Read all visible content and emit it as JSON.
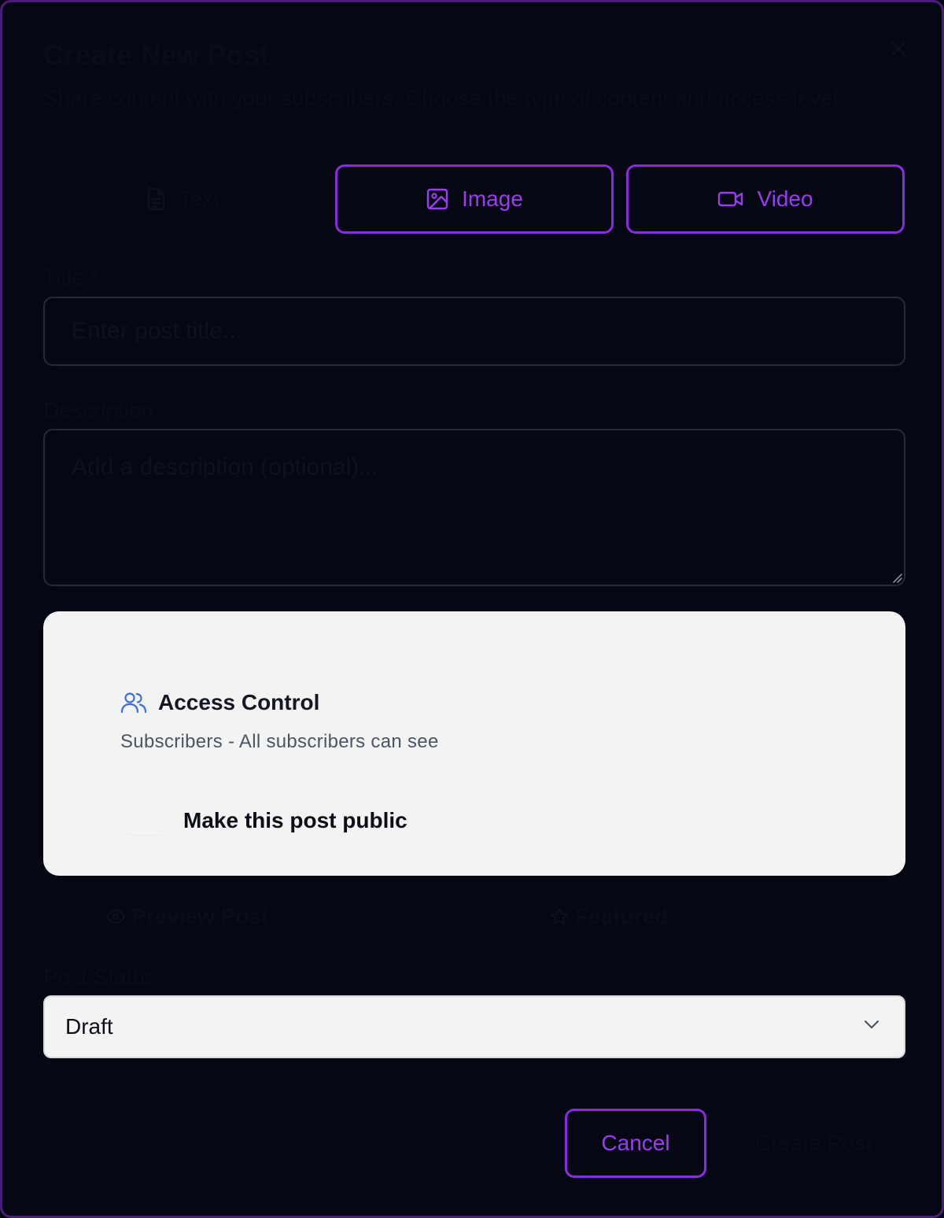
{
  "dialog": {
    "title": "Create New Post",
    "subtitle": "Share content with your subscribers. Choose the type of content and access level."
  },
  "content_types": {
    "text": {
      "label": "Text",
      "icon": "file-text-icon"
    },
    "image": {
      "label": "Image",
      "icon": "image-icon"
    },
    "video": {
      "label": "Video",
      "icon": "video-icon"
    }
  },
  "form": {
    "title_label": "Title *",
    "title_placeholder": "Enter post title...",
    "description_label": "Description",
    "description_placeholder": "Add a description (optional)..."
  },
  "access": {
    "title": "Access Control",
    "subtitle": "Subscribers - All subscribers can see",
    "public_toggle_label": "Make this post public",
    "public_toggle_on": false,
    "icon": "users-icon"
  },
  "options": {
    "preview_label": "Preview Post",
    "featured_label": "Featured"
  },
  "status": {
    "label": "Post Status",
    "value": "Draft"
  },
  "actions": {
    "cancel_label": "Cancel",
    "create_label": "Create Post"
  },
  "colors": {
    "background": "#050713",
    "accent": "#8a2be2",
    "accent_text": "#9b3cf0",
    "card": "#f2f3f2",
    "access_icon": "#3b6fe0"
  }
}
